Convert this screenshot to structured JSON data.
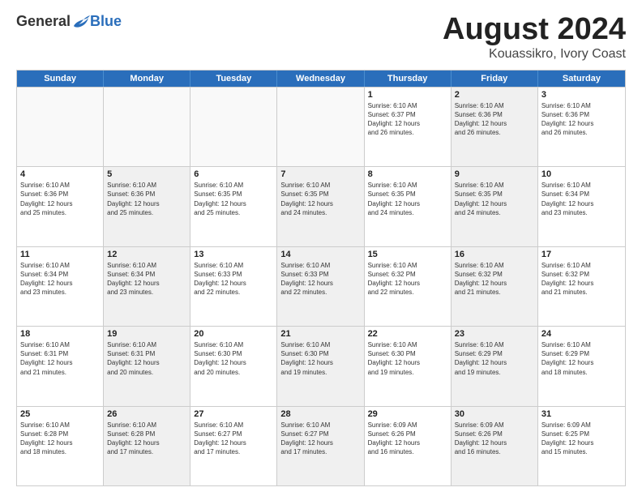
{
  "header": {
    "logo": {
      "general": "General",
      "blue": "Blue"
    },
    "title": "August 2024",
    "subtitle": "Kouassikro, Ivory Coast"
  },
  "calendar": {
    "weekdays": [
      "Sunday",
      "Monday",
      "Tuesday",
      "Wednesday",
      "Thursday",
      "Friday",
      "Saturday"
    ],
    "weeks": [
      [
        {
          "day": "",
          "info": "",
          "empty": true
        },
        {
          "day": "",
          "info": "",
          "empty": true
        },
        {
          "day": "",
          "info": "",
          "empty": true
        },
        {
          "day": "",
          "info": "",
          "empty": true
        },
        {
          "day": "1",
          "info": "Sunrise: 6:10 AM\nSunset: 6:37 PM\nDaylight: 12 hours\nand 26 minutes.",
          "empty": false,
          "shaded": false
        },
        {
          "day": "2",
          "info": "Sunrise: 6:10 AM\nSunset: 6:36 PM\nDaylight: 12 hours\nand 26 minutes.",
          "empty": false,
          "shaded": true
        },
        {
          "day": "3",
          "info": "Sunrise: 6:10 AM\nSunset: 6:36 PM\nDaylight: 12 hours\nand 26 minutes.",
          "empty": false,
          "shaded": false
        }
      ],
      [
        {
          "day": "4",
          "info": "Sunrise: 6:10 AM\nSunset: 6:36 PM\nDaylight: 12 hours\nand 25 minutes.",
          "empty": false,
          "shaded": false
        },
        {
          "day": "5",
          "info": "Sunrise: 6:10 AM\nSunset: 6:36 PM\nDaylight: 12 hours\nand 25 minutes.",
          "empty": false,
          "shaded": true
        },
        {
          "day": "6",
          "info": "Sunrise: 6:10 AM\nSunset: 6:35 PM\nDaylight: 12 hours\nand 25 minutes.",
          "empty": false,
          "shaded": false
        },
        {
          "day": "7",
          "info": "Sunrise: 6:10 AM\nSunset: 6:35 PM\nDaylight: 12 hours\nand 24 minutes.",
          "empty": false,
          "shaded": true
        },
        {
          "day": "8",
          "info": "Sunrise: 6:10 AM\nSunset: 6:35 PM\nDaylight: 12 hours\nand 24 minutes.",
          "empty": false,
          "shaded": false
        },
        {
          "day": "9",
          "info": "Sunrise: 6:10 AM\nSunset: 6:35 PM\nDaylight: 12 hours\nand 24 minutes.",
          "empty": false,
          "shaded": true
        },
        {
          "day": "10",
          "info": "Sunrise: 6:10 AM\nSunset: 6:34 PM\nDaylight: 12 hours\nand 23 minutes.",
          "empty": false,
          "shaded": false
        }
      ],
      [
        {
          "day": "11",
          "info": "Sunrise: 6:10 AM\nSunset: 6:34 PM\nDaylight: 12 hours\nand 23 minutes.",
          "empty": false,
          "shaded": false
        },
        {
          "day": "12",
          "info": "Sunrise: 6:10 AM\nSunset: 6:34 PM\nDaylight: 12 hours\nand 23 minutes.",
          "empty": false,
          "shaded": true
        },
        {
          "day": "13",
          "info": "Sunrise: 6:10 AM\nSunset: 6:33 PM\nDaylight: 12 hours\nand 22 minutes.",
          "empty": false,
          "shaded": false
        },
        {
          "day": "14",
          "info": "Sunrise: 6:10 AM\nSunset: 6:33 PM\nDaylight: 12 hours\nand 22 minutes.",
          "empty": false,
          "shaded": true
        },
        {
          "day": "15",
          "info": "Sunrise: 6:10 AM\nSunset: 6:32 PM\nDaylight: 12 hours\nand 22 minutes.",
          "empty": false,
          "shaded": false
        },
        {
          "day": "16",
          "info": "Sunrise: 6:10 AM\nSunset: 6:32 PM\nDaylight: 12 hours\nand 21 minutes.",
          "empty": false,
          "shaded": true
        },
        {
          "day": "17",
          "info": "Sunrise: 6:10 AM\nSunset: 6:32 PM\nDaylight: 12 hours\nand 21 minutes.",
          "empty": false,
          "shaded": false
        }
      ],
      [
        {
          "day": "18",
          "info": "Sunrise: 6:10 AM\nSunset: 6:31 PM\nDaylight: 12 hours\nand 21 minutes.",
          "empty": false,
          "shaded": false
        },
        {
          "day": "19",
          "info": "Sunrise: 6:10 AM\nSunset: 6:31 PM\nDaylight: 12 hours\nand 20 minutes.",
          "empty": false,
          "shaded": true
        },
        {
          "day": "20",
          "info": "Sunrise: 6:10 AM\nSunset: 6:30 PM\nDaylight: 12 hours\nand 20 minutes.",
          "empty": false,
          "shaded": false
        },
        {
          "day": "21",
          "info": "Sunrise: 6:10 AM\nSunset: 6:30 PM\nDaylight: 12 hours\nand 19 minutes.",
          "empty": false,
          "shaded": true
        },
        {
          "day": "22",
          "info": "Sunrise: 6:10 AM\nSunset: 6:30 PM\nDaylight: 12 hours\nand 19 minutes.",
          "empty": false,
          "shaded": false
        },
        {
          "day": "23",
          "info": "Sunrise: 6:10 AM\nSunset: 6:29 PM\nDaylight: 12 hours\nand 19 minutes.",
          "empty": false,
          "shaded": true
        },
        {
          "day": "24",
          "info": "Sunrise: 6:10 AM\nSunset: 6:29 PM\nDaylight: 12 hours\nand 18 minutes.",
          "empty": false,
          "shaded": false
        }
      ],
      [
        {
          "day": "25",
          "info": "Sunrise: 6:10 AM\nSunset: 6:28 PM\nDaylight: 12 hours\nand 18 minutes.",
          "empty": false,
          "shaded": false
        },
        {
          "day": "26",
          "info": "Sunrise: 6:10 AM\nSunset: 6:28 PM\nDaylight: 12 hours\nand 17 minutes.",
          "empty": false,
          "shaded": true
        },
        {
          "day": "27",
          "info": "Sunrise: 6:10 AM\nSunset: 6:27 PM\nDaylight: 12 hours\nand 17 minutes.",
          "empty": false,
          "shaded": false
        },
        {
          "day": "28",
          "info": "Sunrise: 6:10 AM\nSunset: 6:27 PM\nDaylight: 12 hours\nand 17 minutes.",
          "empty": false,
          "shaded": true
        },
        {
          "day": "29",
          "info": "Sunrise: 6:09 AM\nSunset: 6:26 PM\nDaylight: 12 hours\nand 16 minutes.",
          "empty": false,
          "shaded": false
        },
        {
          "day": "30",
          "info": "Sunrise: 6:09 AM\nSunset: 6:26 PM\nDaylight: 12 hours\nand 16 minutes.",
          "empty": false,
          "shaded": true
        },
        {
          "day": "31",
          "info": "Sunrise: 6:09 AM\nSunset: 6:25 PM\nDaylight: 12 hours\nand 15 minutes.",
          "empty": false,
          "shaded": false
        }
      ]
    ]
  }
}
